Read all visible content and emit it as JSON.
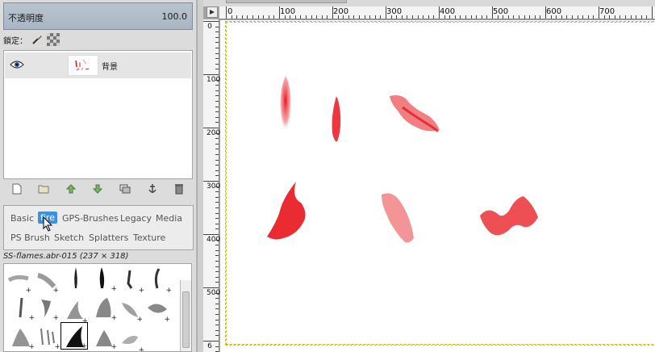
{
  "layers_panel": {
    "opacity_label": "不透明度",
    "opacity_value": "100.0",
    "lock_label": "鎖定：",
    "layer_name": "背景"
  },
  "brush_tags": {
    "tags": [
      "Basic",
      "fire",
      "GPS-Brushes",
      "Legacy",
      "Media",
      "PS Brush",
      "Sketch",
      "Splatters",
      "Texture"
    ],
    "active_tag": "fire"
  },
  "brush_info": {
    "selected_name": "SS-flames.abr-015 (237 × 318)"
  },
  "rulers": {
    "horizontal_labels": [
      "0",
      "100",
      "200",
      "300",
      "400",
      "500",
      "600",
      "700"
    ],
    "vertical_labels": [
      "0",
      "100",
      "200",
      "300",
      "400",
      "500",
      "6"
    ]
  },
  "colors": {
    "flame": "#e8141b",
    "active_tag": "#3f8fdc",
    "opacity_bar": "#a9b6c3"
  }
}
